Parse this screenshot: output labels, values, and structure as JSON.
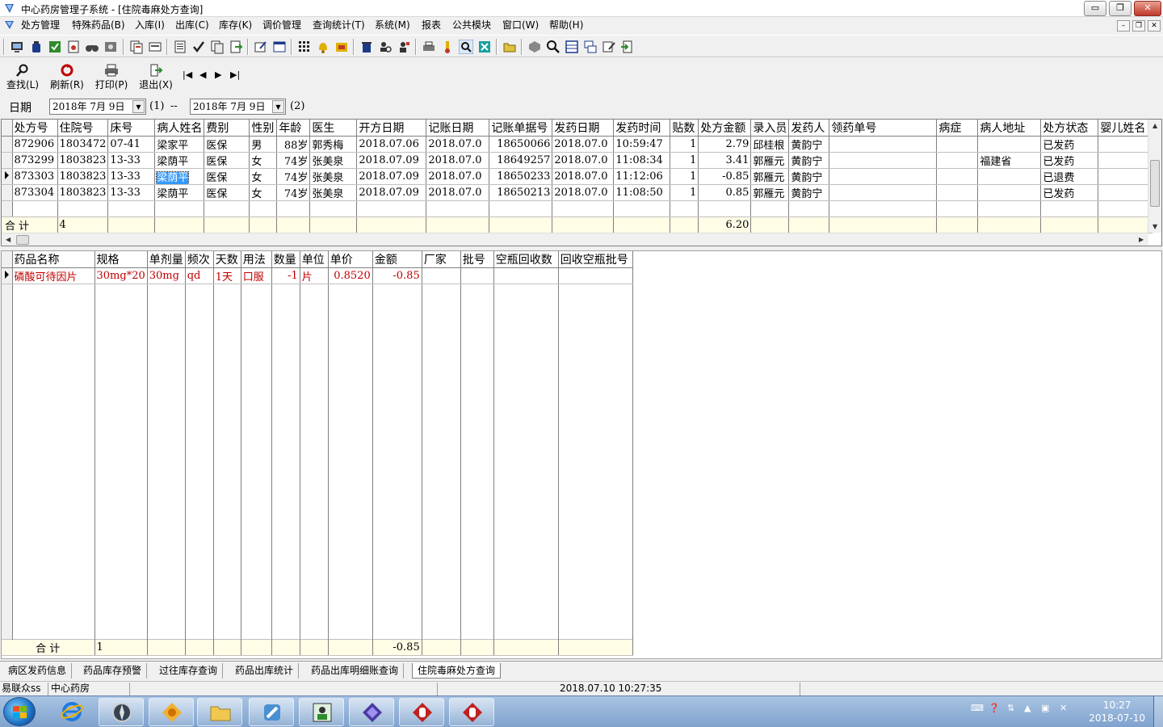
{
  "window": {
    "title": "中心药房管理子系统 - [住院毒麻处方查询]",
    "min_glyph": "▭",
    "restore_glyph": "❐",
    "close_glyph": "✕"
  },
  "menu": [
    {
      "label": "处方管理"
    },
    {
      "label": "特殊药品(B)"
    },
    {
      "label": "入库(I)"
    },
    {
      "label": "出库(C)"
    },
    {
      "label": "库存(K)"
    },
    {
      "label": "调价管理"
    },
    {
      "label": "查询统计(T)"
    },
    {
      "label": "系统(M)"
    },
    {
      "label": "报表"
    },
    {
      "label": "公共模块"
    },
    {
      "label": "窗口(W)"
    },
    {
      "label": "帮助(H)"
    }
  ],
  "mdi_controls": {
    "min": "–",
    "restore": "❐",
    "close": "✕"
  },
  "actions": {
    "find": "查找(L)",
    "refresh": "刷新(R)",
    "print": "打印(P)",
    "exit": "退出(X)",
    "nav_first": "|◀",
    "nav_prev": "◀",
    "nav_next": "▶",
    "nav_last": "▶|"
  },
  "date_filter": {
    "label": "日期",
    "start": "2018年 7月 9日",
    "start_note": "(1)",
    "separator": "--",
    "end": "2018年 7月 9日",
    "end_note": "(2)",
    "dropdown_glyph": "▼"
  },
  "prescriptions": {
    "columns": [
      "处方号",
      "住院号",
      "床号",
      "病人姓名",
      "费别",
      "性别",
      "年龄",
      "医生",
      "开方日期",
      "记账日期",
      "记账单据号",
      "发药日期",
      "发药时间",
      "贴数",
      "处方金额",
      "录入员",
      "发药人",
      "领药单号",
      "病症",
      "病人地址",
      "处方状态",
      "婴儿姓名"
    ],
    "rows": [
      {
        "c0": "872906",
        "c1": "1803472",
        "c2": "07-41",
        "c3": "梁家平",
        "c4": "医保",
        "c5": "男",
        "c6": "88岁",
        "c7": "郭秀梅",
        "c8": "2018.07.06",
        "c9": "2018.07.0",
        "c10": "18650066",
        "c11": "2018.07.0",
        "c12": "10:59:47",
        "c13": "1",
        "c14": "2.79",
        "c15": "邱桂根",
        "c16": "黄韵宁",
        "c17": "",
        "c18": "",
        "c19": "",
        "c20": "已发药",
        "c21": ""
      },
      {
        "c0": "873299",
        "c1": "1803823",
        "c2": "13-33",
        "c3": "梁荫平",
        "c4": "医保",
        "c5": "女",
        "c6": "74岁",
        "c7": "张美泉",
        "c8": "2018.07.09",
        "c9": "2018.07.0",
        "c10": "18649257",
        "c11": "2018.07.0",
        "c12": "11:08:34",
        "c13": "1",
        "c14": "3.41",
        "c15": "郭雁元",
        "c16": "黄韵宁",
        "c17": "",
        "c18": "",
        "c19": "福建省",
        "c20": "已发药",
        "c21": ""
      },
      {
        "c0": "873303",
        "c1": "1803823",
        "c2": "13-33",
        "c3": "梁荫平",
        "c4": "医保",
        "c5": "女",
        "c6": "74岁",
        "c7": "张美泉",
        "c8": "2018.07.09",
        "c9": "2018.07.0",
        "c10": "18650233",
        "c11": "2018.07.0",
        "c12": "11:12:06",
        "c13": "1",
        "c14": "-0.85",
        "c15": "郭雁元",
        "c16": "黄韵宁",
        "c17": "",
        "c18": "",
        "c19": "",
        "c20": "已退费",
        "c21": ""
      },
      {
        "c0": "873304",
        "c1": "1803823",
        "c2": "13-33",
        "c3": "梁荫平",
        "c4": "医保",
        "c5": "女",
        "c6": "74岁",
        "c7": "张美泉",
        "c8": "2018.07.09",
        "c9": "2018.07.0",
        "c10": "18650213",
        "c11": "2018.07.0",
        "c12": "11:08:50",
        "c13": "1",
        "c14": "0.85",
        "c15": "郭雁元",
        "c16": "黄韵宁",
        "c17": "",
        "c18": "",
        "c19": "",
        "c20": "已发药",
        "c21": ""
      }
    ],
    "selected_row": 2,
    "total_label": "合 计",
    "total_count": "4",
    "total_amount": "6.20"
  },
  "details": {
    "columns": [
      "药品名称",
      "规格",
      "单剂量",
      "频次",
      "天数",
      "用法",
      "数量",
      "单位",
      "单价",
      "金额",
      "厂家",
      "批号",
      "空瓶回收数",
      "回收空瓶批号"
    ],
    "rows": [
      {
        "c0": "磷酸可待因片",
        "c1": "30mg*20",
        "c2": "30mg",
        "c3": "qd",
        "c4": "1天",
        "c5": "口服",
        "c6": "-1",
        "c7": "片",
        "c8": "0.8520",
        "c9": "-0.85",
        "c10": "",
        "c11": "",
        "c12": "",
        "c13": ""
      }
    ],
    "total_label": "合 计",
    "total_count": "1",
    "total_amount": "-0.85"
  },
  "tabs": [
    {
      "label": "病区发药信息"
    },
    {
      "label": "药品库存预警"
    },
    {
      "label": "过往库存查询"
    },
    {
      "label": "药品出库统计"
    },
    {
      "label": "药品出库明细账查询"
    },
    {
      "label": "住院毒麻处方查询"
    }
  ],
  "status": {
    "user": "易联众ss",
    "department": "中心药房",
    "datetime": "2018.07.10 10:27:35"
  },
  "taskbar": {
    "apps": [
      "ie-icon",
      "compass-icon",
      "pharmacy-icon",
      "folder-icon",
      "tool-icon",
      "doctor-icon",
      "diamond-icon",
      "pill-icon",
      "pill-icon"
    ],
    "clock_time": "10:27",
    "clock_date": "2018-07-10"
  },
  "colors": {
    "selection": "#3399ff",
    "detail_text": "#c00000",
    "total_row": "#fffde6"
  }
}
